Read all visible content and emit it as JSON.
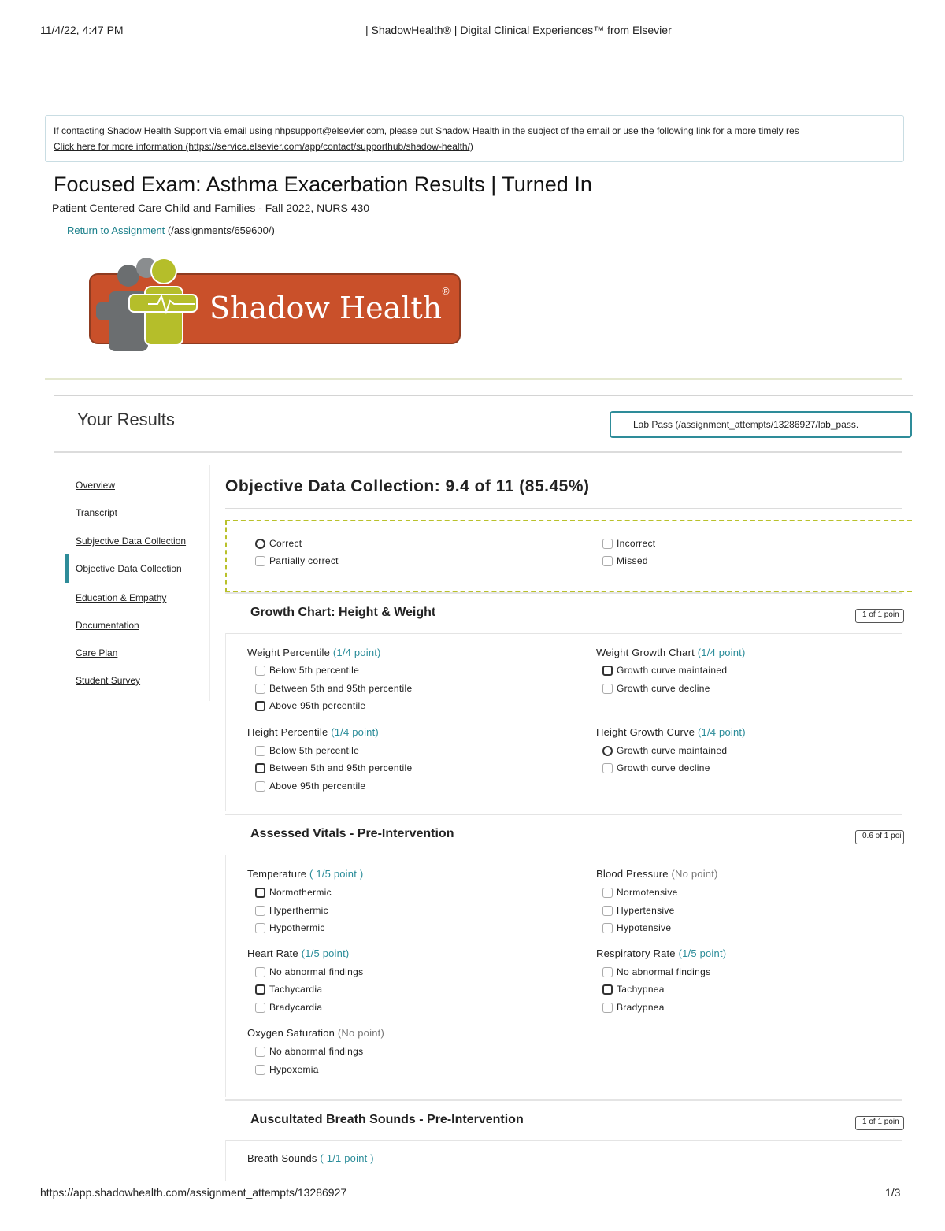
{
  "pdf_header": {
    "datetime": "11/4/22, 4:47 PM",
    "page_title": "| ShadowHealth® | Digital Clinical Experiences™ from Elsevier"
  },
  "pdf_footer": {
    "url": "https://app.shadowhealth.com/assignment_attempts/13286927",
    "page": "1/3"
  },
  "notice": {
    "line1": "If contacting Shadow Health Support via email using nhpsupport@elsevier.com, please put Shadow Health in the subject of the email or use the following link for a more timely res",
    "line2": "Click here for more information (https://service.elsevier.com/app/contact/supporthub/shadow-health/)"
  },
  "page": {
    "title": "Focused Exam: Asthma Exacerbation Results | Turned In",
    "subtitle": "Patient Centered Care Child and Families - Fall 2022, NURS 430",
    "return_link": "Return to Assignment",
    "return_path": "(/assignments/659600/)"
  },
  "logo": {
    "text": "Shadow Health",
    "reg": "®",
    "colors": {
      "orange": "#c9502a",
      "green": "#b5be2a",
      "gray": "#6b6e70"
    }
  },
  "results": {
    "title": "Your Results",
    "lab_pass": "Lab Pass (/assignment_attempts/13286927/lab_pass."
  },
  "nav": {
    "items": [
      "Overview",
      "Transcript",
      "Subjective Data Collection",
      "Objective Data Collection",
      "Education & Empathy",
      "Documentation",
      "Care Plan",
      "Student Survey"
    ],
    "active_index": 3
  },
  "section": {
    "title": "Objective Data Collection: 9.4 of 11 (85.45%)"
  },
  "legend": {
    "correct": "Correct",
    "partially_correct": "Partially correct",
    "incorrect": "Incorrect",
    "missed": "Missed"
  },
  "blocks": {
    "growth": {
      "title": "Growth Chart: Height & Weight",
      "score": "1 of 1 poin",
      "q1": {
        "label": "Weight Percentile",
        "pts": "(1/4 point)",
        "options": [
          "Below 5th percentile",
          "Between 5th and 95th percentile",
          "Above 95th percentile"
        ]
      },
      "q2": {
        "label": "Weight Growth Chart",
        "pts": "(1/4 point)",
        "options": [
          "Growth curve maintained",
          "Growth curve decline"
        ]
      },
      "q3": {
        "label": "Height Percentile",
        "pts": "(1/4 point)",
        "options": [
          "Below 5th percentile",
          "Between 5th and 95th percentile",
          "Above 95th percentile"
        ]
      },
      "q4": {
        "label": "Height Growth Curve",
        "pts": "(1/4 point)",
        "options": [
          "Growth curve maintained",
          "Growth curve decline"
        ]
      }
    },
    "vitals": {
      "title": "Assessed Vitals - Pre-Intervention",
      "score": "0.6 of 1 poi",
      "q1": {
        "label": "Temperature",
        "pts": "( 1/5 point )",
        "options": [
          "Normothermic",
          "Hyperthermic",
          "Hypothermic"
        ]
      },
      "q2": {
        "label": "Blood Pressure",
        "pts": "(No point)",
        "options": [
          "Normotensive",
          "Hypertensive",
          "Hypotensive"
        ]
      },
      "q3": {
        "label": "Heart Rate",
        "pts": "(1/5 point)",
        "options": [
          "No abnormal findings",
          "Tachycardia",
          "Bradycardia"
        ]
      },
      "q4": {
        "label": "Respiratory Rate",
        "pts": "(1/5 point)",
        "options": [
          "No abnormal findings",
          "Tachypnea",
          "Bradypnea"
        ]
      },
      "q5": {
        "label": "Oxygen Saturation",
        "pts": "(No point)",
        "options": [
          "No abnormal findings",
          "Hypoxemia"
        ]
      }
    },
    "breath": {
      "title": "Auscultated Breath Sounds - Pre-Intervention",
      "score": "1 of 1 poin",
      "q1": {
        "label": "Breath Sounds",
        "pts": "( 1/1 point )"
      }
    }
  }
}
